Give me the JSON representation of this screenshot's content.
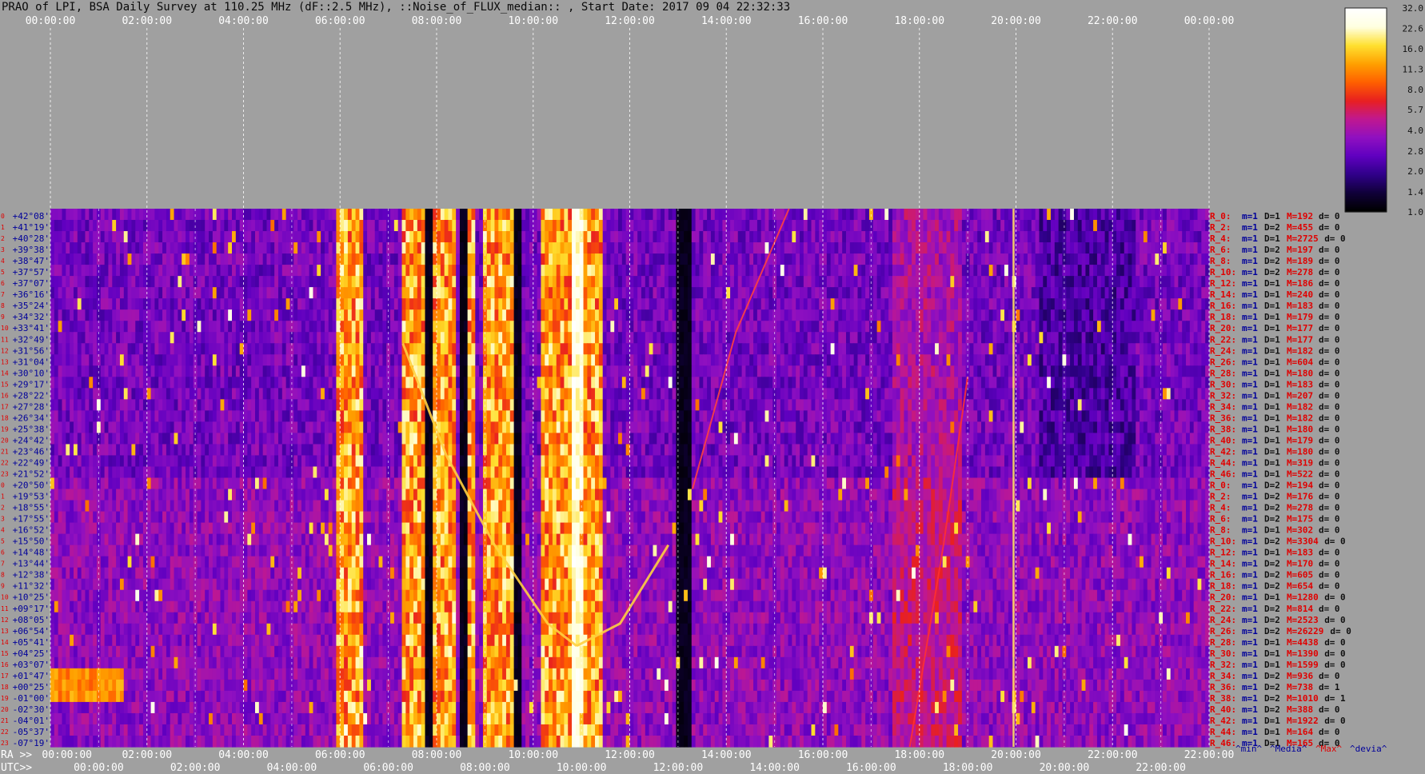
{
  "title": "PRAO of LPI, BSA Daily Survey at 110.25 MHz (dF::2.5 MHz), ::Noise_of_FLUX_median:: , Start Date: 2017 09 04 22:32:33",
  "chart_data": {
    "type": "heatmap",
    "top_time_ticks": [
      "00:00:00",
      "02:00:00",
      "04:00:00",
      "06:00:00",
      "08:00:00",
      "10:00:00",
      "12:00:00",
      "14:00:00",
      "16:00:00",
      "18:00:00",
      "20:00:00",
      "22:00:00",
      "00:00:00"
    ],
    "ra_ticks": [
      "00:00:00",
      "02:00:00",
      "04:00:00",
      "06:00:00",
      "08:00:00",
      "10:00:00",
      "12:00:00",
      "14:00:00",
      "16:00:00",
      "18:00:00",
      "20:00:00",
      "22:00:00",
      "22:00:00"
    ],
    "utc_ticks": [
      "00:00:00",
      "02:00:00",
      "04:00:00",
      "06:00:00",
      "08:00:00",
      "10:00:00",
      "12:00:00",
      "14:00:00",
      "16:00:00",
      "18:00:00",
      "20:00:00",
      "22:00:00"
    ],
    "ra_label": "RA >>",
    "utc_label": "UTC>>",
    "declinations": [
      "+42°08'",
      "+41°19'",
      "+40°28'",
      "+39°38'",
      "+38°47'",
      "+37°57'",
      "+37°07'",
      "+36°16'",
      "+35°24'",
      "+34°32'",
      "+33°41'",
      "+32°49'",
      "+31°56'",
      "+31°04'",
      "+30°10'",
      "+29°17'",
      "+28°22'",
      "+27°28'",
      "+26°34'",
      "+25°38'",
      "+24°42'",
      "+23°46'",
      "+22°49'",
      "+21°52'",
      "+20°50'",
      "+19°53'",
      "+18°55'",
      "+17°55'",
      "+16°52'",
      "+15°50'",
      "+14°48'",
      "+13°44'",
      "+12°38'",
      "+11°32'",
      "+10°25'",
      "+09°17'",
      "+08°05'",
      "+06°54'",
      "+05°41'",
      "+04°25'",
      "+03°07'",
      "+01°47'",
      "+00°25'",
      "-01°00'",
      "-02°30'",
      "-04°01'",
      "-05°37'",
      "-07°19'"
    ],
    "row_index_labels": [
      "0",
      "1",
      "2",
      "3",
      "4",
      "5",
      "6",
      "7",
      "8",
      "9",
      "10",
      "11",
      "12",
      "13",
      "14",
      "15",
      "16",
      "17",
      "18",
      "19",
      "20",
      "21",
      "22",
      "23",
      "0",
      "1",
      "2",
      "3",
      "4",
      "5",
      "6",
      "7",
      "8",
      "9",
      "10",
      "11",
      "12",
      "13",
      "14",
      "15",
      "16",
      "17",
      "18",
      "19",
      "20",
      "21",
      "22",
      "23"
    ],
    "row_stats": [
      {
        "r": "R_0:",
        "m": "m=1",
        "D": "D=1",
        "M": "M=192",
        "d": "d= 0"
      },
      {
        "r": "R_2:",
        "m": "m=1",
        "D": "D=2",
        "M": "M=455",
        "d": "d= 0"
      },
      {
        "r": "R_4:",
        "m": "m=1",
        "D": "D=1",
        "M": "M=2725",
        "d": "d= 0"
      },
      {
        "r": "R_6:",
        "m": "m=1",
        "D": "D=2",
        "M": "M=197",
        "d": "d= 0"
      },
      {
        "r": "R_8:",
        "m": "m=1",
        "D": "D=2",
        "M": "M=189",
        "d": "d= 0"
      },
      {
        "r": "R_10:",
        "m": "m=1",
        "D": "D=2",
        "M": "M=278",
        "d": "d= 0"
      },
      {
        "r": "R_12:",
        "m": "m=1",
        "D": "D=1",
        "M": "M=186",
        "d": "d= 0"
      },
      {
        "r": "R_14:",
        "m": "m=1",
        "D": "D=1",
        "M": "M=240",
        "d": "d= 0"
      },
      {
        "r": "R_16:",
        "m": "m=1",
        "D": "D=1",
        "M": "M=183",
        "d": "d= 0"
      },
      {
        "r": "R_18:",
        "m": "m=1",
        "D": "D=1",
        "M": "M=179",
        "d": "d= 0"
      },
      {
        "r": "R_20:",
        "m": "m=1",
        "D": "D=1",
        "M": "M=177",
        "d": "d= 0"
      },
      {
        "r": "R_22:",
        "m": "m=1",
        "D": "D=1",
        "M": "M=177",
        "d": "d= 0"
      },
      {
        "r": "R_24:",
        "m": "m=1",
        "D": "D=1",
        "M": "M=182",
        "d": "d= 0"
      },
      {
        "r": "R_26:",
        "m": "m=1",
        "D": "D=1",
        "M": "M=604",
        "d": "d= 0"
      },
      {
        "r": "R_28:",
        "m": "m=1",
        "D": "D=1",
        "M": "M=180",
        "d": "d= 0"
      },
      {
        "r": "R_30:",
        "m": "m=1",
        "D": "D=1",
        "M": "M=183",
        "d": "d= 0"
      },
      {
        "r": "R_32:",
        "m": "m=1",
        "D": "D=1",
        "M": "M=207",
        "d": "d= 0"
      },
      {
        "r": "R_34:",
        "m": "m=1",
        "D": "D=1",
        "M": "M=182",
        "d": "d= 0"
      },
      {
        "r": "R_36:",
        "m": "m=1",
        "D": "D=1",
        "M": "M=182",
        "d": "d= 0"
      },
      {
        "r": "R_38:",
        "m": "m=1",
        "D": "D=1",
        "M": "M=180",
        "d": "d= 0"
      },
      {
        "r": "R_40:",
        "m": "m=1",
        "D": "D=1",
        "M": "M=179",
        "d": "d= 0"
      },
      {
        "r": "R_42:",
        "m": "m=1",
        "D": "D=1",
        "M": "M=180",
        "d": "d= 0"
      },
      {
        "r": "R_44:",
        "m": "m=1",
        "D": "D=1",
        "M": "M=319",
        "d": "d= 0"
      },
      {
        "r": "R_46:",
        "m": "m=1",
        "D": "D=1",
        "M": "M=522",
        "d": "d= 0"
      },
      {
        "r": "R_0:",
        "m": "m=1",
        "D": "D=2",
        "M": "M=194",
        "d": "d= 0"
      },
      {
        "r": "R_2:",
        "m": "m=1",
        "D": "D=2",
        "M": "M=176",
        "d": "d= 0"
      },
      {
        "r": "R_4:",
        "m": "m=1",
        "D": "D=2",
        "M": "M=278",
        "d": "d= 0"
      },
      {
        "r": "R_6:",
        "m": "m=1",
        "D": "D=2",
        "M": "M=175",
        "d": "d= 0"
      },
      {
        "r": "R_8:",
        "m": "m=1",
        "D": "D=1",
        "M": "M=302",
        "d": "d= 0"
      },
      {
        "r": "R_10:",
        "m": "m=1",
        "D": "D=2",
        "M": "M=3304",
        "d": "d= 0"
      },
      {
        "r": "R_12:",
        "m": "m=1",
        "D": "D=1",
        "M": "M=183",
        "d": "d= 0"
      },
      {
        "r": "R_14:",
        "m": "m=1",
        "D": "D=2",
        "M": "M=170",
        "d": "d= 0"
      },
      {
        "r": "R_16:",
        "m": "m=1",
        "D": "D=2",
        "M": "M=605",
        "d": "d= 0"
      },
      {
        "r": "R_18:",
        "m": "m=1",
        "D": "D=2",
        "M": "M=654",
        "d": "d= 0"
      },
      {
        "r": "R_20:",
        "m": "m=1",
        "D": "D=1",
        "M": "M=1280",
        "d": "d= 0"
      },
      {
        "r": "R_22:",
        "m": "m=1",
        "D": "D=2",
        "M": "M=814",
        "d": "d= 0"
      },
      {
        "r": "R_24:",
        "m": "m=1",
        "D": "D=2",
        "M": "M=2523",
        "d": "d= 0"
      },
      {
        "r": "R_26:",
        "m": "m=1",
        "D": "D=2",
        "M": "M=26229",
        "d": "d= 0"
      },
      {
        "r": "R_28:",
        "m": "m=1",
        "D": "D=1",
        "M": "M=4438",
        "d": "d= 0"
      },
      {
        "r": "R_30:",
        "m": "m=1",
        "D": "D=1",
        "M": "M=1390",
        "d": "d= 0"
      },
      {
        "r": "R_32:",
        "m": "m=1",
        "D": "D=1",
        "M": "M=1599",
        "d": "d= 0"
      },
      {
        "r": "R_34:",
        "m": "m=1",
        "D": "D=2",
        "M": "M=936",
        "d": "d= 0"
      },
      {
        "r": "R_36:",
        "m": "m=1",
        "D": "D=2",
        "M": "M=738",
        "d": "d= 1"
      },
      {
        "r": "R_38:",
        "m": "m=1",
        "D": "D=2",
        "M": "M=1010",
        "d": "d= 1"
      },
      {
        "r": "R_40:",
        "m": "m=1",
        "D": "D=2",
        "M": "M=388",
        "d": "d= 0"
      },
      {
        "r": "R_42:",
        "m": "m=1",
        "D": "D=1",
        "M": "M=1922",
        "d": "d= 0"
      },
      {
        "r": "R_44:",
        "m": "m=1",
        "D": "D=1",
        "M": "M=164",
        "d": "d= 0"
      },
      {
        "r": "R_46:",
        "m": "m=1",
        "D": "D=1",
        "M": "M=165",
        "d": "d= 0"
      }
    ],
    "stat_legend": [
      {
        "text": "^min^",
        "color": "#00009a"
      },
      {
        "text": "^Media^",
        "color": "#00009a"
      },
      {
        "text": "^Max^",
        "color": "#e00000"
      },
      {
        "text": "^devia^",
        "color": "#00009a"
      }
    ],
    "colorbar_ticks": [
      "32.0",
      "22.6",
      "16.0",
      "11.3",
      "8.0",
      "5.7",
      "4.0",
      "2.8",
      "2.0",
      "1.4",
      "1.0"
    ],
    "colorbar_range": [
      1.0,
      32.0
    ],
    "colorbar_scale": "log",
    "colormap": [
      "#000000",
      "#10003a",
      "#30008a",
      "#6000c0",
      "#9010c0",
      "#c01890",
      "#e82020",
      "#ff6000",
      "#ffa000",
      "#ffe030",
      "#ffffe0",
      "#ffffff"
    ],
    "bright_bands_utc_hours": [
      [
        5.9,
        6.5
      ],
      [
        7.3,
        7.8
      ],
      [
        7.9,
        8.4
      ],
      [
        8.6,
        8.8
      ],
      [
        9.0,
        9.6
      ],
      [
        10.2,
        11.4
      ]
    ],
    "dark_gaps_utc_hours": [
      [
        7.8,
        7.95
      ],
      [
        8.45,
        8.6
      ],
      [
        9.6,
        9.75
      ],
      [
        13.0,
        13.3
      ]
    ],
    "bright_time_axis_color": "#ff8000"
  }
}
